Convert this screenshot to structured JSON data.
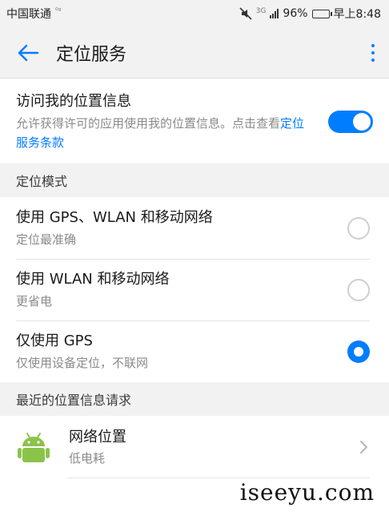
{
  "status_bar": {
    "carrier": "中国联通",
    "carrier_extra": "⁰ᵍ",
    "network_type": "3G",
    "battery": "96%",
    "time": "早上8:48"
  },
  "app_bar": {
    "title": "定位服务"
  },
  "location_access": {
    "title": "访问我的位置信息",
    "desc_prefix": "允许获得许可的应用使用我的位置信息。点击查看",
    "desc_link": "定位服务条款",
    "enabled": true
  },
  "mode_section": {
    "header": "定位模式",
    "options": [
      {
        "title": "使用 GPS、WLAN 和移动网络",
        "subtitle": "定位最准确",
        "selected": false
      },
      {
        "title": "使用 WLAN 和移动网络",
        "subtitle": "更省电",
        "selected": false
      },
      {
        "title": "仅使用 GPS",
        "subtitle": "仅使用设备定位，不联网",
        "selected": true
      }
    ]
  },
  "recent_section": {
    "header": "最近的位置信息请求",
    "items": [
      {
        "title": "网络位置",
        "subtitle": "低电耗",
        "icon": "android-icon"
      }
    ]
  },
  "watermark": "iseeyu.com",
  "colors": {
    "accent": "#007dff",
    "android_green": "#8bc34a"
  }
}
